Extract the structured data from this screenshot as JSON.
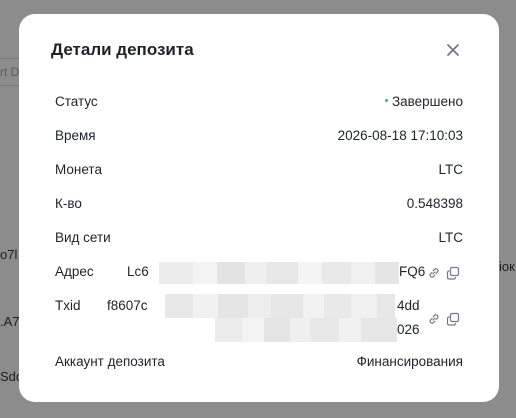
{
  "background": {
    "search_placeholder": "rt D",
    "row_fragments": [
      "o7l",
      ".A7",
      "Sdo"
    ],
    "right_fragment": "ioк"
  },
  "modal": {
    "title": "Детали депозита",
    "close_icon": "close-icon",
    "fields": {
      "status": {
        "label": "Статус",
        "value": "Завершено",
        "indicator_color": "#0ecb81"
      },
      "time": {
        "label": "Время",
        "value": "2026-08-18 17:10:03"
      },
      "coin": {
        "label": "Монета",
        "value": "LTC"
      },
      "amount": {
        "label": "К-во",
        "value": "0.548398"
      },
      "network": {
        "label": "Вид сети",
        "value": "LTC"
      },
      "address": {
        "label": "Адрес",
        "value_start": "Lc6",
        "value_end": "FQ6",
        "icons": [
          "link-icon",
          "copy-icon"
        ]
      },
      "txid": {
        "label": "Txid",
        "value_start": "f8607c",
        "value_end_line1": "4dd",
        "value_end_line2": "026",
        "icons": [
          "link-icon",
          "copy-icon"
        ]
      },
      "account": {
        "label": "Аккаунт депозита",
        "value": "Финансирования"
      }
    }
  },
  "colors": {
    "overlay": "#8c8c8c",
    "modal_bg": "#ffffff",
    "text_primary": "#1e2329",
    "status_green": "#0ecb81"
  }
}
